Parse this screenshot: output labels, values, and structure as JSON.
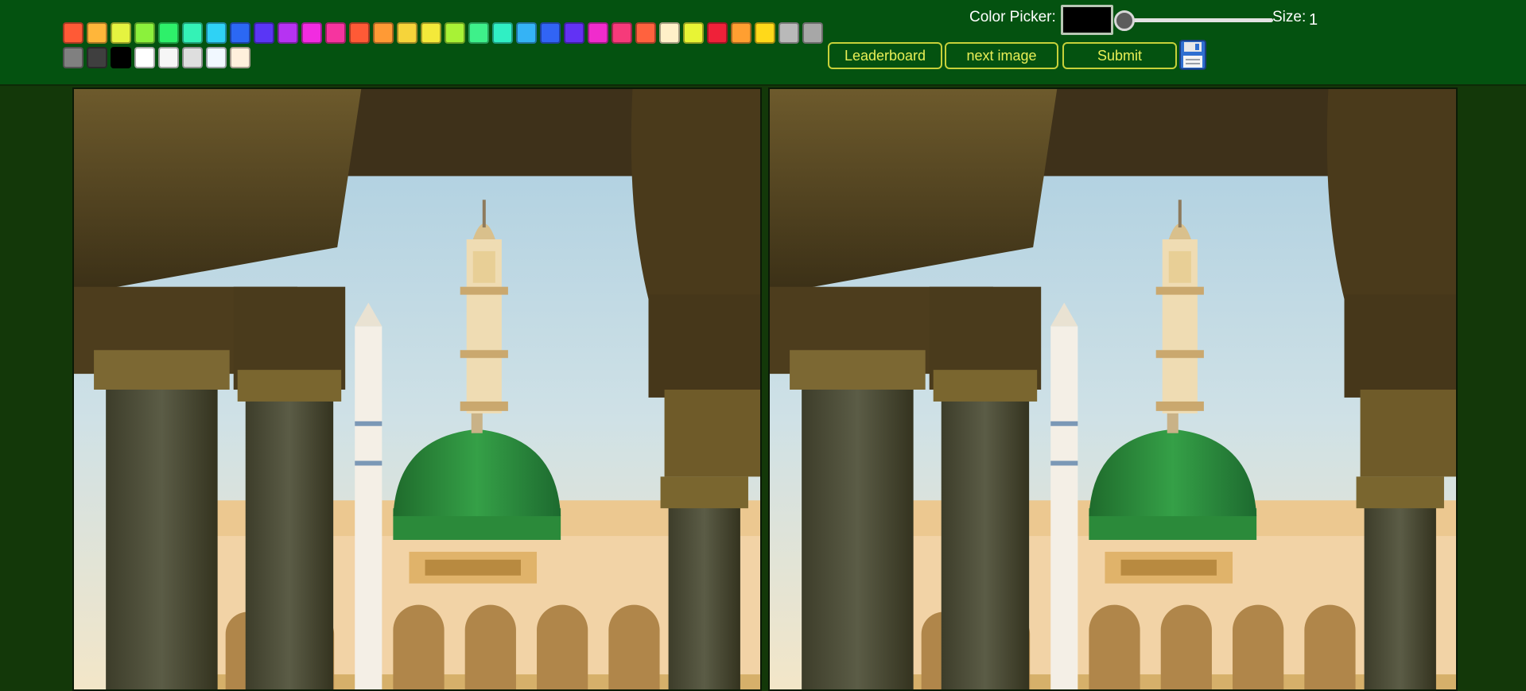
{
  "toolbar": {
    "palette": {
      "row1": [
        "#ff5a36",
        "#ffb63a",
        "#e5f340",
        "#8bf13c",
        "#2ef06a",
        "#34f2b6",
        "#2fd2f5",
        "#2b68f4",
        "#5a36f5",
        "#b633f2",
        "#f12ce0",
        "#f6349f",
        "#ff5a36",
        "#ff9a35",
        "#f6d43a",
        "#f4e93a",
        "#a8f236",
        "#3ef08a",
        "#30efc4",
        "#35b3f5",
        "#3164f5",
        "#6232f4",
        "#f02ccc",
        "#f63a7a",
        "#ff623e",
        "#fff0c8",
        "#e8f435",
        "#ef2139",
        "#ff9f31",
        "#ffd91a",
        "#b9b9b9",
        "#a7a7a7"
      ],
      "row2": [
        "#808080",
        "#3f3f3f",
        "#000000",
        "#ffffff",
        "#f6f6f6",
        "#dedede",
        "#f1f8ff",
        "#fff0dc"
      ]
    },
    "color_picker_label": "Color Picker:",
    "color_picker_value": "#000000",
    "size_label": "Size:",
    "size_value": "1",
    "size_slider_level": 0,
    "buttons": {
      "leaderboard": "Leaderboard",
      "next_image": "next image",
      "submit": "Submit"
    },
    "save_icon": "floppy-disk-icon"
  },
  "colors": {
    "topbar_bg": "#045210",
    "page_bg": "#133809",
    "button_text": "#e9ef56",
    "button_border": "#c7d13a"
  },
  "canvases": {
    "left": "original-image-canvas",
    "right": "drawing-canvas"
  }
}
